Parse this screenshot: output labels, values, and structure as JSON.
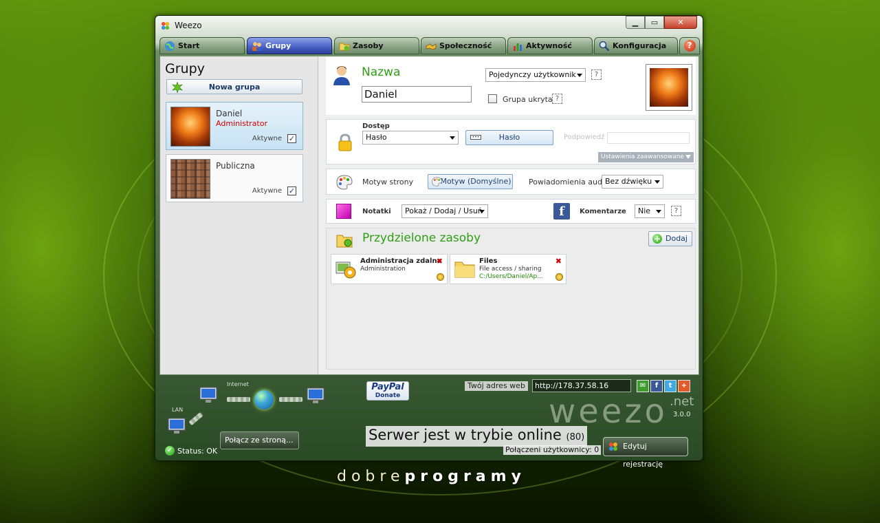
{
  "window": {
    "title": "Weezo",
    "controls": [
      "minimize",
      "maximize",
      "close"
    ]
  },
  "tabs": [
    {
      "label": "Start",
      "icon": "globe-icon"
    },
    {
      "label": "Grupy",
      "icon": "users-icon",
      "active": true
    },
    {
      "label": "Zasoby",
      "icon": "folder-icon"
    },
    {
      "label": "Społeczność",
      "icon": "handshake-icon"
    },
    {
      "label": "Aktywność",
      "icon": "activity-chart-icon"
    },
    {
      "label": "Konfiguracja",
      "icon": "magnifier-icon"
    }
  ],
  "left_panel": {
    "title": "Grupy",
    "new_group_label": "Nowa grupa",
    "groups": [
      {
        "name": "Daniel",
        "role": "Administrator",
        "active_label": "Aktywne",
        "active": true,
        "selected": true
      },
      {
        "name": "Publiczna",
        "role": "",
        "active_label": "Aktywne",
        "active": true,
        "selected": false
      }
    ]
  },
  "details": {
    "name_label": "Nazwa",
    "name_value": "Daniel",
    "user_type": "Pojedynczy użytkownik",
    "hidden_group_label": "Grupa ukryta",
    "hidden_group_checked": false,
    "help_mark": "?",
    "access_label": "Dostęp",
    "access_value": "Hasło",
    "password_button": "Hasło",
    "hint_label": "Podpowiedź",
    "advanced_settings": "Ustawienia zaawansowane",
    "theme_label": "Motyw strony",
    "theme_button": "Motyw (Domyślne)",
    "audio_label": "Powiadomienia audio",
    "audio_value": "Bez dźwięku",
    "notes_label": "Notatki",
    "notes_value": "Pokaż / Dodaj / Usuń",
    "comments_label": "Komentarze",
    "comments_value": "Nie",
    "facebook_glyph": "f"
  },
  "resources": {
    "title": "Przydzielone zasoby",
    "add_label": "Dodaj",
    "items": [
      {
        "name": "Administracja zdalna",
        "type": "Administration",
        "path": "",
        "icon": "remote-admin-icon"
      },
      {
        "name": "Files",
        "type": "File access / sharing",
        "path": "C:/Users/Daniel/Ap...",
        "icon": "folder-icon"
      }
    ]
  },
  "status_bar": {
    "internet_label": "Internet",
    "lan_label": "LAN",
    "connect_button": "Połącz ze stroną...",
    "status_text": "Status: OK",
    "paypal_brand": "PayPal",
    "paypal_donate": "Donate",
    "address_label": "Twój adres web",
    "address_value": "http://178.37.58.16",
    "logo_text": "weezo",
    "logo_tld": ".net",
    "version": "3.0.0",
    "online_text": "Serwer jest w trybie online",
    "online_count": "(80)",
    "users_connected": "Połączeni użytkownicy: 0",
    "edit_registration": "Edytuj rejestrację"
  },
  "branding": {
    "prefix": "dobre",
    "suffix": "programy"
  },
  "colors": {
    "accent_green": "#2d9f12",
    "active_tab": "#4a63c7",
    "admin_red": "#d10000"
  }
}
